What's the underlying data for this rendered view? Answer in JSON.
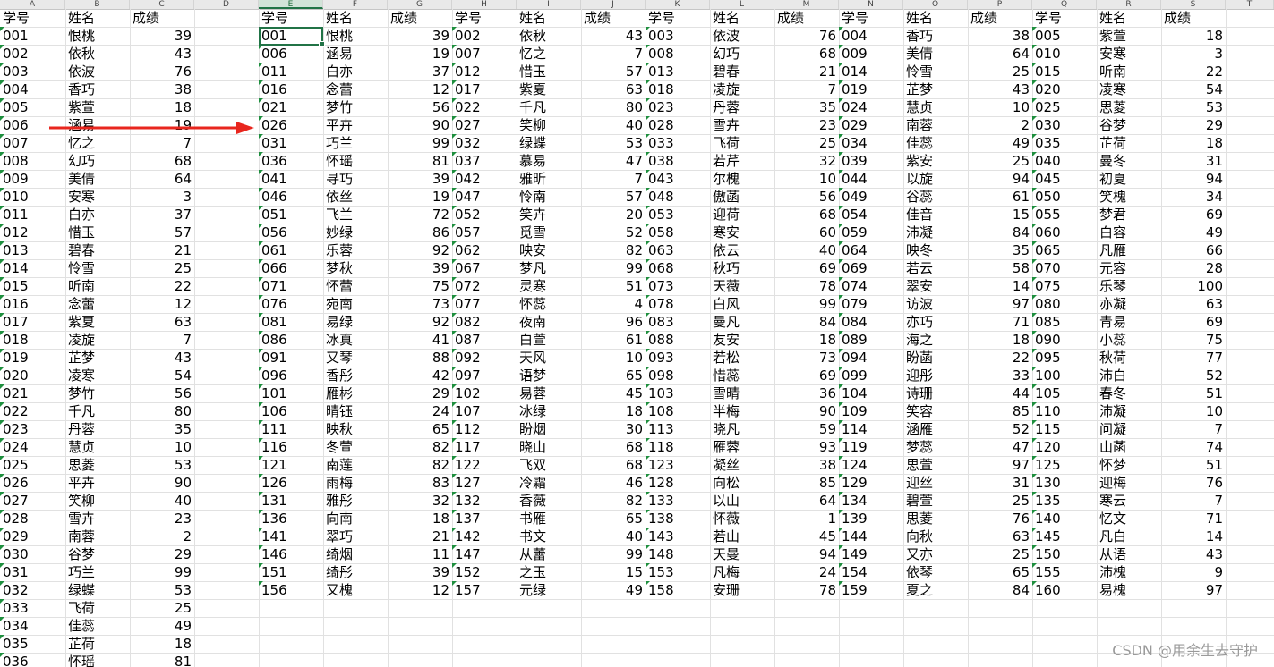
{
  "column_letters": [
    "A",
    "B",
    "C",
    "D",
    "E",
    "F",
    "G",
    "H",
    "I",
    "J",
    "K",
    "L",
    "M",
    "N",
    "O",
    "P",
    "Q",
    "R",
    "S",
    "T"
  ],
  "headers": {
    "id": "学号",
    "name": "姓名",
    "score": "成绩"
  },
  "source": {
    "ids": [
      "001",
      "002",
      "003",
      "004",
      "005",
      "006",
      "007",
      "008",
      "009",
      "010",
      "011",
      "012",
      "013",
      "014",
      "015",
      "016",
      "017",
      "018",
      "019",
      "020",
      "021",
      "022",
      "023",
      "024",
      "025",
      "026",
      "027",
      "028",
      "029",
      "030",
      "031",
      "032",
      "033",
      "034",
      "035",
      "036"
    ],
    "names": [
      "恨桃",
      "依秋",
      "依波",
      "香巧",
      "紫萱",
      "涵易",
      "忆之",
      "幻巧",
      "美倩",
      "安寒",
      "白亦",
      "惜玉",
      "碧春",
      "怜雪",
      "听南",
      "念蕾",
      "紫夏",
      "凌旋",
      "芷梦",
      "凌寒",
      "梦竹",
      "千凡",
      "丹蓉",
      "慧贞",
      "思菱",
      "平卉",
      "笑柳",
      "雪卉",
      "南蓉",
      "谷梦",
      "巧兰",
      "绿蝶",
      "飞荷",
      "佳蕊",
      "芷荷",
      "怀瑶"
    ],
    "scores": [
      "39",
      "43",
      "76",
      "38",
      "18",
      "19",
      "7",
      "68",
      "64",
      "3",
      "37",
      "57",
      "21",
      "25",
      "22",
      "12",
      "63",
      "7",
      "43",
      "54",
      "56",
      "80",
      "35",
      "10",
      "53",
      "90",
      "40",
      "23",
      "2",
      "29",
      "99",
      "53",
      "25",
      "49",
      "18",
      "81"
    ]
  },
  "blocks": [
    {
      "ids": [
        "001",
        "006",
        "011",
        "016",
        "021",
        "026",
        "031",
        "036",
        "041",
        "046",
        "051",
        "056",
        "061",
        "066",
        "071",
        "076",
        "081",
        "086",
        "091",
        "096",
        "101",
        "106",
        "111",
        "116",
        "121",
        "126",
        "131",
        "136",
        "141",
        "146",
        "151",
        "156"
      ],
      "names": [
        "恨桃",
        "涵易",
        "白亦",
        "念蕾",
        "梦竹",
        "平卉",
        "巧兰",
        "怀瑶",
        "寻巧",
        "依丝",
        "飞兰",
        "妙绿",
        "乐蓉",
        "梦秋",
        "怀蕾",
        "宛南",
        "易绿",
        "冰真",
        "又琴",
        "香彤",
        "雁彬",
        "晴钰",
        "映秋",
        "冬萱",
        "南莲",
        "雨梅",
        "雅彤",
        "向南",
        "翠巧",
        "绮烟",
        "绮彤",
        "又槐"
      ],
      "scores": [
        "39",
        "19",
        "37",
        "12",
        "56",
        "90",
        "99",
        "81",
        "39",
        "19",
        "72",
        "86",
        "92",
        "39",
        "75",
        "73",
        "92",
        "41",
        "88",
        "42",
        "29",
        "24",
        "65",
        "82",
        "82",
        "83",
        "32",
        "18",
        "21",
        "11",
        "39",
        "12"
      ]
    },
    {
      "ids": [
        "002",
        "007",
        "012",
        "017",
        "022",
        "027",
        "032",
        "037",
        "042",
        "047",
        "052",
        "057",
        "062",
        "067",
        "072",
        "077",
        "082",
        "087",
        "092",
        "097",
        "102",
        "107",
        "112",
        "117",
        "122",
        "127",
        "132",
        "137",
        "142",
        "147",
        "152",
        "157"
      ],
      "names": [
        "依秋",
        "忆之",
        "惜玉",
        "紫夏",
        "千凡",
        "笑柳",
        "绿蝶",
        "慕易",
        "雅昕",
        "怜南",
        "笑卉",
        "觅雪",
        "映安",
        "梦凡",
        "灵寒",
        "怀蕊",
        "夜南",
        "白萱",
        "天风",
        "语梦",
        "易蓉",
        "冰绿",
        "盼烟",
        "晓山",
        "飞双",
        "冷霜",
        "香薇",
        "书雁",
        "书文",
        "从蕾",
        "之玉",
        "元绿"
      ],
      "scores": [
        "43",
        "7",
        "57",
        "63",
        "80",
        "40",
        "53",
        "47",
        "7",
        "57",
        "20",
        "52",
        "82",
        "99",
        "51",
        "4",
        "96",
        "61",
        "10",
        "65",
        "45",
        "18",
        "30",
        "68",
        "68",
        "46",
        "82",
        "65",
        "40",
        "99",
        "15",
        "49"
      ]
    },
    {
      "ids": [
        "003",
        "008",
        "013",
        "018",
        "023",
        "028",
        "033",
        "038",
        "043",
        "048",
        "053",
        "058",
        "063",
        "068",
        "073",
        "078",
        "083",
        "088",
        "093",
        "098",
        "103",
        "108",
        "113",
        "118",
        "123",
        "128",
        "133",
        "138",
        "143",
        "148",
        "153",
        "158"
      ],
      "names": [
        "依波",
        "幻巧",
        "碧春",
        "凌旋",
        "丹蓉",
        "雪卉",
        "飞荷",
        "若芹",
        "尔槐",
        "傲菡",
        "迎荷",
        "寒安",
        "依云",
        "秋巧",
        "天薇",
        "白风",
        "曼凡",
        "友安",
        "若松",
        "惜蕊",
        "雪晴",
        "半梅",
        "晓凡",
        "雁蓉",
        "凝丝",
        "向松",
        "以山",
        "怀薇",
        "若山",
        "天曼",
        "凡梅",
        "安珊"
      ],
      "scores": [
        "76",
        "68",
        "21",
        "7",
        "35",
        "23",
        "25",
        "32",
        "10",
        "56",
        "68",
        "60",
        "40",
        "69",
        "78",
        "99",
        "84",
        "18",
        "73",
        "69",
        "36",
        "90",
        "59",
        "93",
        "38",
        "85",
        "64",
        "1",
        "45",
        "94",
        "24",
        "78"
      ]
    },
    {
      "ids": [
        "004",
        "009",
        "014",
        "019",
        "024",
        "029",
        "034",
        "039",
        "044",
        "049",
        "054",
        "059",
        "064",
        "069",
        "074",
        "079",
        "084",
        "089",
        "094",
        "099",
        "104",
        "109",
        "114",
        "119",
        "124",
        "129",
        "134",
        "139",
        "144",
        "149",
        "154",
        "159"
      ],
      "names": [
        "香巧",
        "美倩",
        "怜雪",
        "芷梦",
        "慧贞",
        "南蓉",
        "佳蕊",
        "紫安",
        "以旋",
        "谷蕊",
        "佳音",
        "沛凝",
        "映冬",
        "若云",
        "翠安",
        "访波",
        "亦巧",
        "海之",
        "盼菡",
        "迎彤",
        "诗珊",
        "笑容",
        "涵雁",
        "梦蕊",
        "思萱",
        "迎丝",
        "碧萱",
        "思菱",
        "向秋",
        "又亦",
        "依琴",
        "夏之"
      ],
      "scores": [
        "38",
        "64",
        "25",
        "43",
        "10",
        "2",
        "49",
        "25",
        "94",
        "61",
        "15",
        "84",
        "35",
        "58",
        "14",
        "97",
        "71",
        "18",
        "22",
        "33",
        "44",
        "85",
        "52",
        "47",
        "97",
        "31",
        "25",
        "76",
        "63",
        "25",
        "65",
        "84"
      ]
    },
    {
      "ids": [
        "005",
        "010",
        "015",
        "020",
        "025",
        "030",
        "035",
        "040",
        "045",
        "050",
        "055",
        "060",
        "065",
        "070",
        "075",
        "080",
        "085",
        "090",
        "095",
        "100",
        "105",
        "110",
        "115",
        "120",
        "125",
        "130",
        "135",
        "140",
        "145",
        "150",
        "155",
        "160"
      ],
      "names": [
        "紫萱",
        "安寒",
        "听南",
        "凌寒",
        "思菱",
        "谷梦",
        "芷荷",
        "曼冬",
        "初夏",
        "笑槐",
        "梦君",
        "白容",
        "凡雁",
        "元容",
        "乐琴",
        "亦凝",
        "青易",
        "小蕊",
        "秋荷",
        "沛白",
        "春冬",
        "沛凝",
        "问凝",
        "山菡",
        "怀梦",
        "迎梅",
        "寒云",
        "忆文",
        "凡白",
        "从语",
        "沛槐",
        "易槐"
      ],
      "scores": [
        "18",
        "3",
        "22",
        "54",
        "53",
        "29",
        "18",
        "31",
        "94",
        "34",
        "69",
        "49",
        "66",
        "28",
        "100",
        "63",
        "69",
        "75",
        "77",
        "52",
        "51",
        "10",
        "7",
        "74",
        "51",
        "76",
        "7",
        "71",
        "14",
        "43",
        "9",
        "97"
      ]
    }
  ],
  "colors": {
    "arrow": "#e8261e",
    "selection": "#217346",
    "grid": "#e1e1e1",
    "header_bg": "#e9e9e9",
    "error_marker": "#1e8f3e"
  },
  "watermark": "CSDN @用余生去守护"
}
